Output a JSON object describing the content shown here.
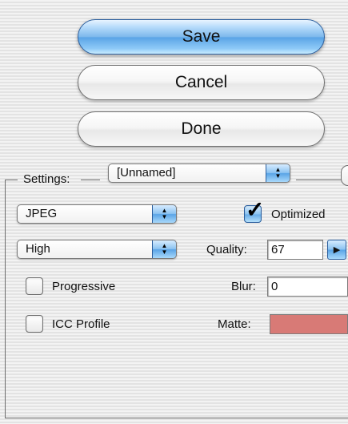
{
  "buttons": {
    "save": "Save",
    "cancel": "Cancel",
    "done": "Done"
  },
  "settings": {
    "label": "Settings:",
    "preset": "[Unnamed]"
  },
  "format": {
    "value": "JPEG"
  },
  "optimized": {
    "label": "Optimized",
    "checked": true
  },
  "quality_preset": {
    "value": "High"
  },
  "quality": {
    "label": "Quality:",
    "value": "67"
  },
  "progressive": {
    "label": "Progressive",
    "checked": false
  },
  "blur": {
    "label": "Blur:",
    "value": "0"
  },
  "icc_profile": {
    "label": "ICC Profile",
    "checked": false
  },
  "matte": {
    "label": "Matte:",
    "color": "#d87a76"
  },
  "icons": {
    "popup_arrows": "up-down-arrows-icon",
    "stepper": "right-triangle-icon",
    "checkmark": "checkmark-icon"
  }
}
